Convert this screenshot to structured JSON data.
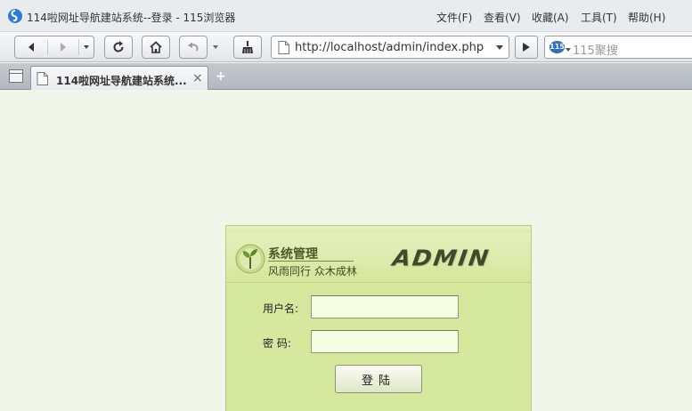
{
  "browser": {
    "app_title": "114啦网址导航建站系统--登录 - 115浏览器",
    "menu": [
      "文件(F)",
      "查看(V)",
      "收藏(A)",
      "工具(T)",
      "帮助(H)"
    ],
    "url": "http://localhost/admin/index.php",
    "search_placeholder": "115聚搜",
    "search_engine_icon_label": "115",
    "tab_title": "114啦网址导航建站系统...",
    "tab_close": "×",
    "new_tab": "+"
  },
  "login": {
    "system_title": "系统管理",
    "slogan": "风雨同行  众木成林",
    "admin_logo_text": "ADMIN",
    "username_label": "用户名:",
    "password_label": "密   码:",
    "username_value": "",
    "password_value": "",
    "submit_label": "登陆"
  },
  "colors": {
    "panel_bg": "#d6e89e",
    "input_bg": "#f7fde3",
    "page_bg": "#f2f5e9"
  }
}
